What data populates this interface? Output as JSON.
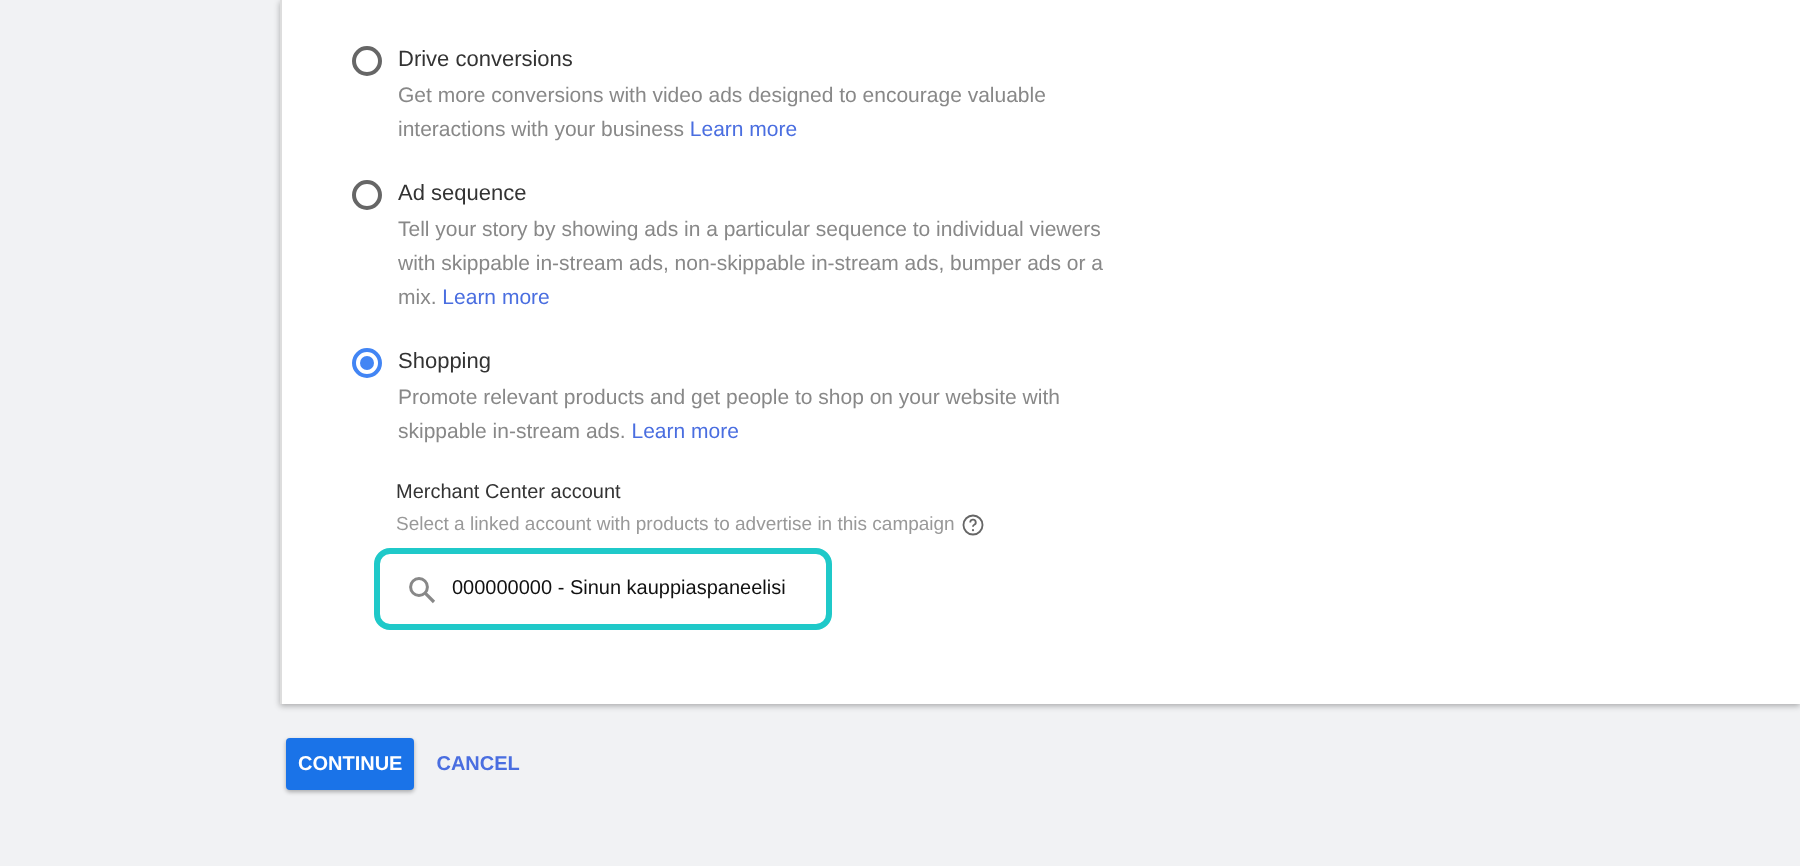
{
  "options": [
    {
      "title": "Drive conversions",
      "description": "Get more conversions with video ads designed to encourage valuable interactions with your business",
      "link": "Learn more",
      "selected": false
    },
    {
      "title": "Ad sequence",
      "description": "Tell your story by showing ads in a particular sequence to individual viewers with skippable in-stream ads, non-skippable in-stream ads, bumper ads or a mix.",
      "link": "Learn more",
      "selected": false
    },
    {
      "title": "Shopping",
      "description": "Promote relevant products and get people to shop on your website with skippable in-stream ads.",
      "link": "Learn more",
      "selected": true
    }
  ],
  "merchant": {
    "label": "Merchant Center account",
    "hint": "Select a linked account with products to advertise in this campaign",
    "value": "000000000 - Sinun kauppiaspaneelisi"
  },
  "buttons": {
    "continue": "CONTINUE",
    "cancel": "CANCEL"
  }
}
